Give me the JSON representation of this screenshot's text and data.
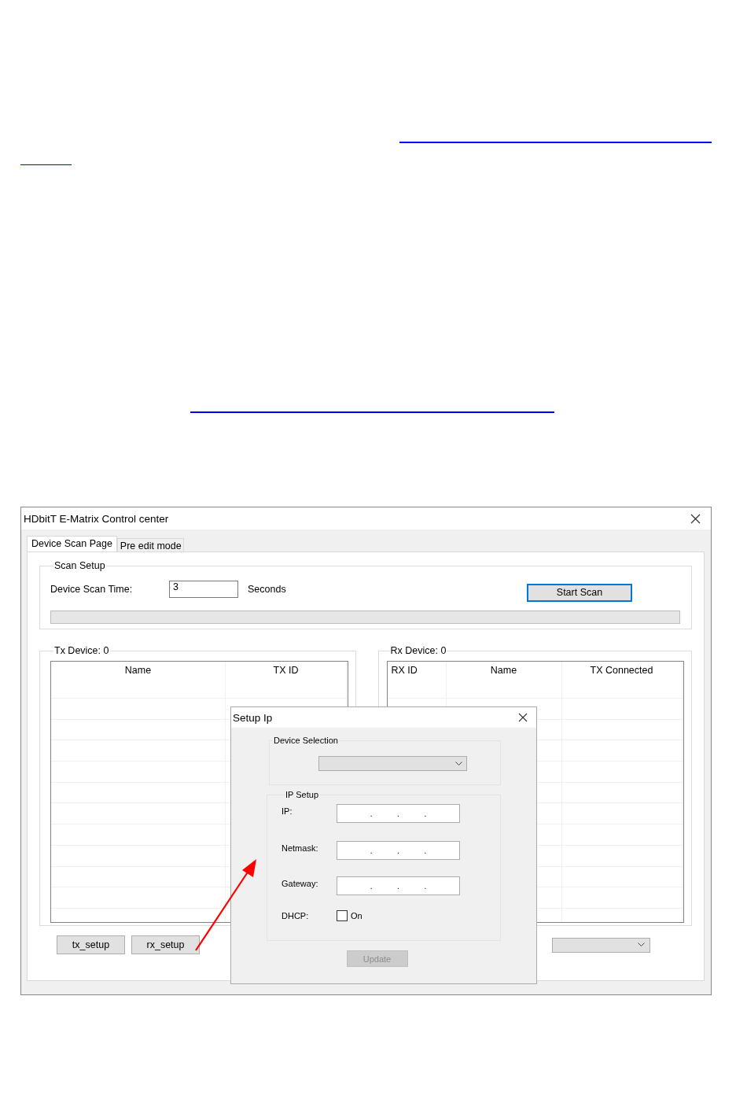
{
  "window": {
    "title": "HDbitT E-Matrix Control center"
  },
  "tabs": [
    {
      "label": "Device Scan Page",
      "selected": true
    },
    {
      "label": "Pre edit mode",
      "selected": false
    }
  ],
  "scan_setup": {
    "title": "Scan Setup",
    "label": "Device Scan Time:",
    "value": "3",
    "unit": "Seconds",
    "button": "Start Scan",
    "progress": {
      "level": 0
    }
  },
  "tx_panel": {
    "title": "Tx Device: 0",
    "columns": [
      "Name",
      "TX ID"
    ]
  },
  "rx_panel": {
    "title": "Rx Device: 0",
    "columns": [
      "RX ID",
      "Name",
      "TX Connected"
    ]
  },
  "buttons": [
    "tx_setup",
    "rx_setup"
  ],
  "dialog": {
    "title": "Setup Ip",
    "device_selection": {
      "title": "Device Selection"
    },
    "ip_setup": {
      "title": "IP Setup",
      "fields": [
        {
          "label": "IP:",
          "separators": [
            ".",
            ".",
            "."
          ]
        },
        {
          "label": "Netmask:",
          "separators": [
            ".",
            ".",
            "."
          ]
        },
        {
          "label": "Gateway:",
          "separators": [
            ".",
            ".",
            "."
          ]
        }
      ],
      "dhcp": {
        "label": "DHCP:",
        "checkbox_label": "On",
        "checked": false
      }
    },
    "update_button": {
      "label": "Update",
      "disabled": true
    }
  }
}
